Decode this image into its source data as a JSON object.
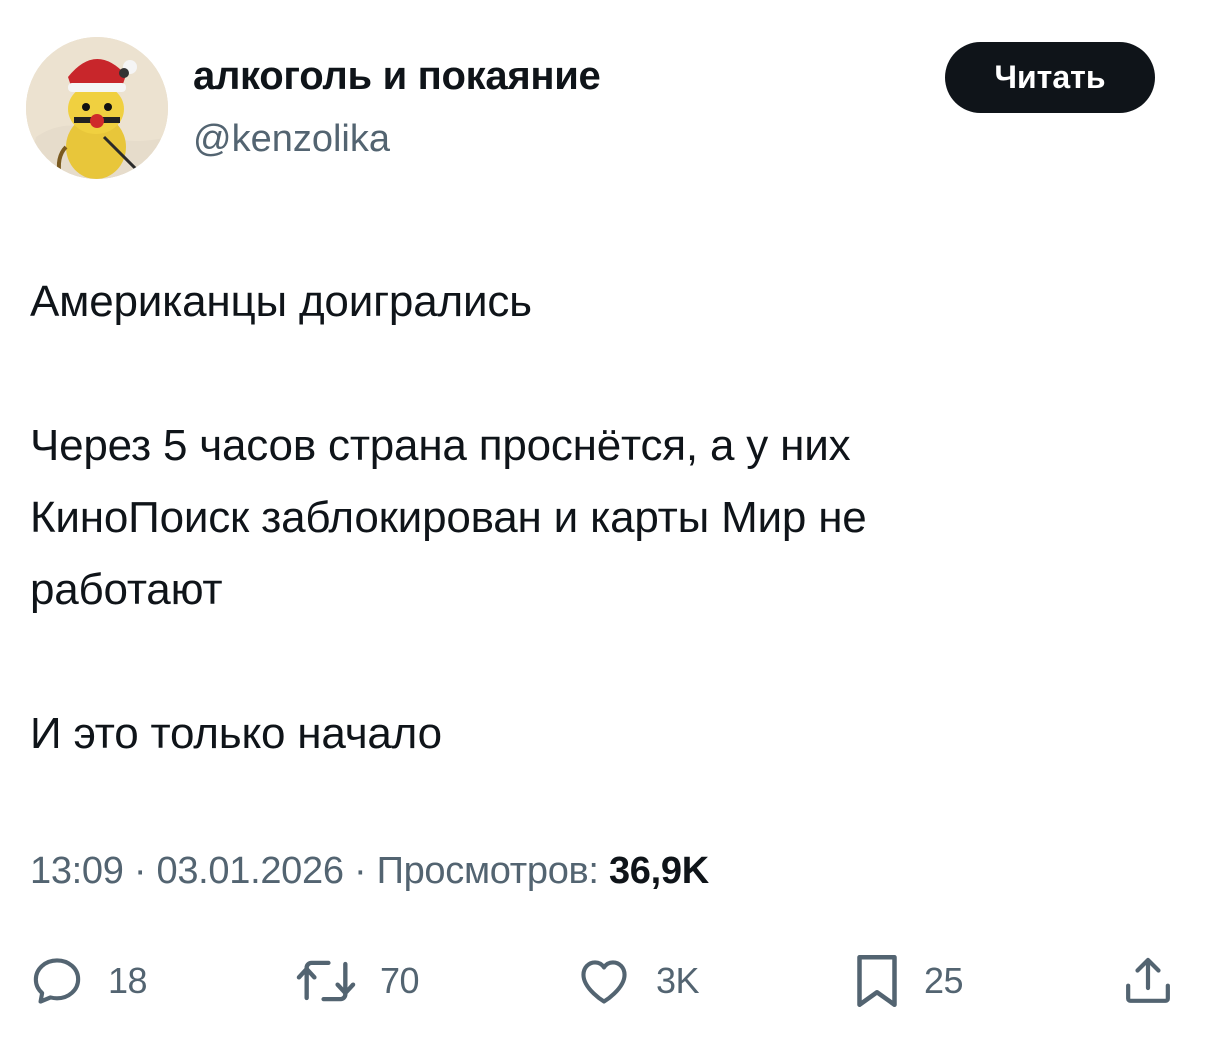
{
  "author": {
    "display_name": "алкоголь и покаяние",
    "handle": "@kenzolika",
    "avatar_icon": "pikachu-santa-avatar"
  },
  "follow_button": {
    "label": "Читать"
  },
  "tweet": {
    "text": "Американцы доигрались\n\nЧерез 5 часов страна проснётся, а у них\nКиноПоиск заблокирован и карты Мир не\nработают\n\nИ это только начало",
    "time": "13:09",
    "date": "03.01.2026",
    "separator": "·",
    "views_label": "Просмотров:",
    "views_count": "36,9K"
  },
  "actions": {
    "reply": {
      "icon": "reply-icon",
      "count": "18"
    },
    "retweet": {
      "icon": "retweet-icon",
      "count": "70"
    },
    "like": {
      "icon": "heart-icon",
      "count": "3K"
    },
    "bookmark": {
      "icon": "bookmark-icon",
      "count": "25"
    },
    "share": {
      "icon": "share-icon"
    }
  },
  "colors": {
    "text": "#0f1419",
    "secondary": "#536471",
    "button_bg": "#0f1419",
    "button_text": "#ffffff"
  }
}
